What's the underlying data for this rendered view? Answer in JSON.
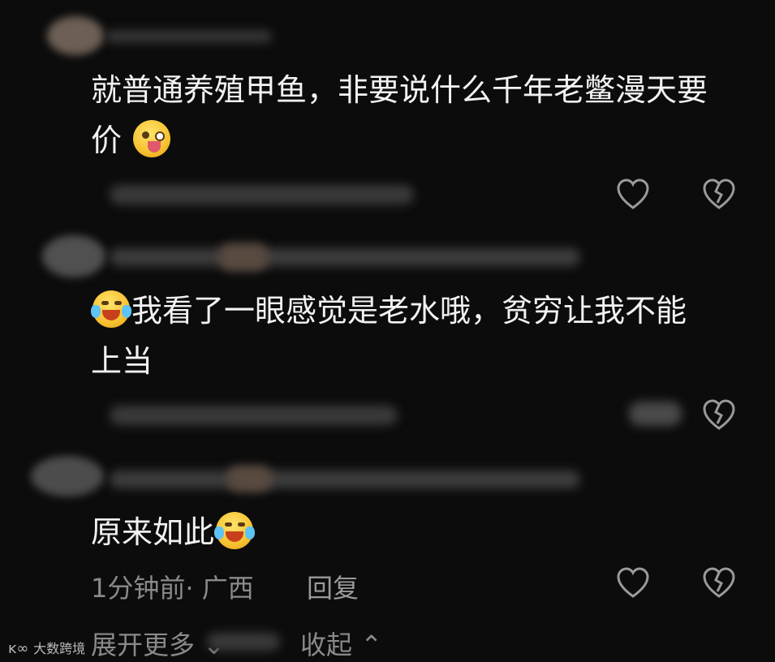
{
  "comments": [
    {
      "text": "就普通养殖甲鱼，非要说什么千年老鳖漫天要价",
      "emoji": "crazy-face-emoji"
    },
    {
      "text": "我看了一眼感觉是老水哦，贫穷让我不能上当",
      "emoji": "crying-laughing-emoji"
    },
    {
      "text": "原来如此",
      "emoji": "crying-laughing-emoji"
    }
  ],
  "reply_meta": {
    "time": "1分钟前",
    "location": "· 广西",
    "reply_label": "回复"
  },
  "expand_label": "展开更多",
  "collapse_label": "收起",
  "watermark": "大数跨境"
}
